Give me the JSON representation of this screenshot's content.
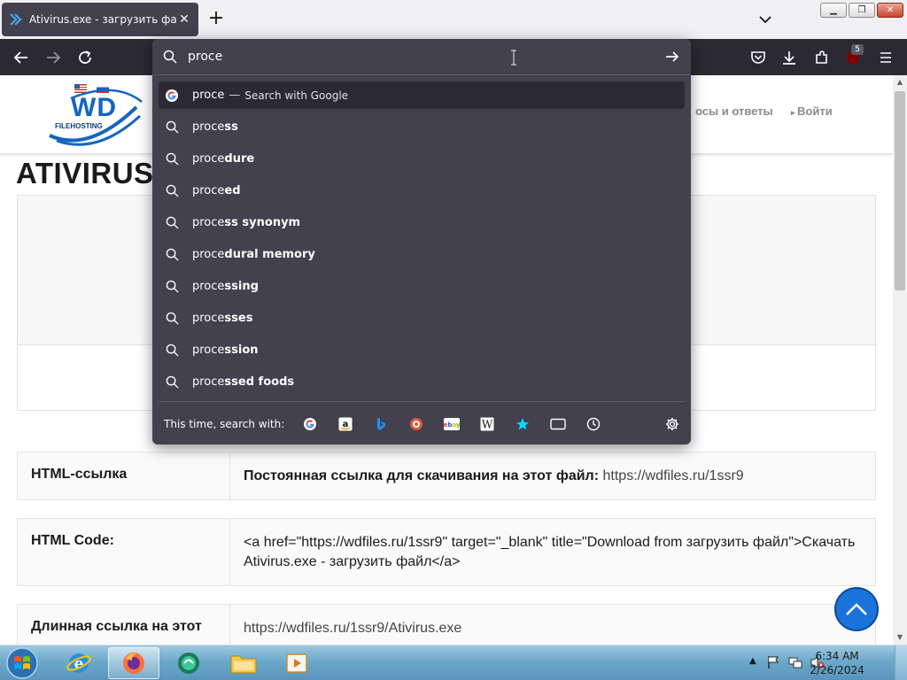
{
  "browser": {
    "tab_title": "Ativirus.exe - загрузить файл",
    "url_input_value": "proce",
    "extension_badge": "5"
  },
  "website": {
    "logo_text": "WD",
    "logo_subtext": "FILEHOSTING",
    "nav_faq": "осы и ответы",
    "nav_login": "Войти",
    "file_heading": "ATIVIRUS",
    "rows": [
      {
        "key": "HTML-ссылка",
        "label": "Постоянная ссылка для скачивания на этот файл:",
        "link": "https://wdfiles.ru/1ssr9"
      },
      {
        "key": "HTML Code:",
        "value": "<a href=\"https://wdfiles.ru/1ssr9\" target=\"_blank\" title=\"Download from загрузить файл\">Скачать Ativirus.exe - загрузить файл</a>"
      },
      {
        "key": "Длинная ссылка на этот",
        "value": "https://wdfiles.ru/1ssr9/Ativirus.exe"
      }
    ]
  },
  "urlbar_dropdown": {
    "google_suggestion": {
      "query": "proce",
      "separator": "—",
      "hint": "Search with Google"
    },
    "suggestions": [
      {
        "typed": "proce",
        "completion": "ss"
      },
      {
        "typed": "proce",
        "completion": "dure"
      },
      {
        "typed": "proce",
        "completion": "ed"
      },
      {
        "typed": "proce",
        "completion": "ss synonym"
      },
      {
        "typed": "proce",
        "completion": "dural memory"
      },
      {
        "typed": "proce",
        "completion": "ssing"
      },
      {
        "typed": "proce",
        "completion": "sses"
      },
      {
        "typed": "proce",
        "completion": "ssion"
      },
      {
        "typed": "proce",
        "completion": "ssed foods"
      }
    ],
    "oneoff_label": "This time, search with:",
    "engines": [
      "google-icon",
      "amazon-icon",
      "bing-icon",
      "duckduckgo-icon",
      "ebay-icon",
      "wikipedia-icon",
      "bookmarks-icon",
      "tabs-icon",
      "history-icon"
    ]
  },
  "taskbar": {
    "clock_time": "6:34 AM",
    "clock_date": "2/26/2024"
  },
  "colors": {
    "chrome_dark": "#2b2a33",
    "panel": "#42414d",
    "accent_blue": "#1a73d9"
  }
}
